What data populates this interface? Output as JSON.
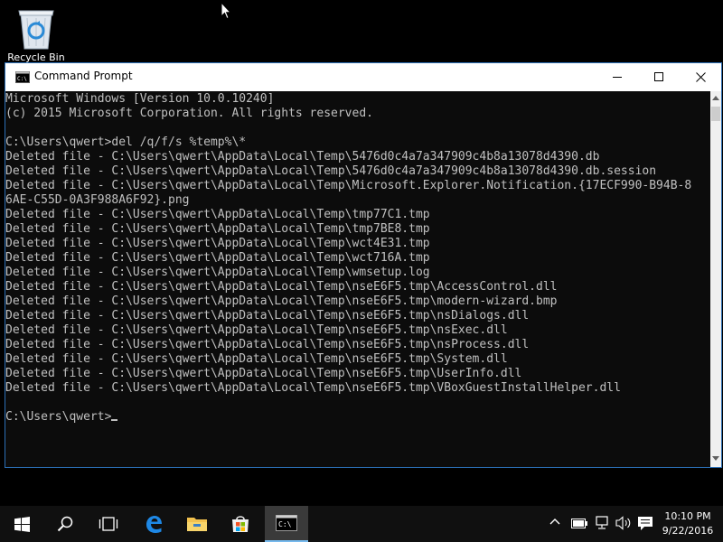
{
  "desktop": {
    "icons": [
      {
        "label": "Recycle Bin",
        "icon": "recycle-bin-icon"
      }
    ]
  },
  "window": {
    "title": "Command Prompt",
    "icon": "cmd-icon",
    "controls": [
      "minimize-icon",
      "maximize-icon",
      "close-icon"
    ]
  },
  "console": {
    "lines": [
      "Microsoft Windows [Version 10.0.10240]",
      "(c) 2015 Microsoft Corporation. All rights reserved.",
      "",
      "C:\\Users\\qwert>del /q/f/s %temp%\\*",
      "Deleted file - C:\\Users\\qwert\\AppData\\Local\\Temp\\5476d0c4a7a347909c4b8a13078d4390.db",
      "Deleted file - C:\\Users\\qwert\\AppData\\Local\\Temp\\5476d0c4a7a347909c4b8a13078d4390.db.session",
      "Deleted file - C:\\Users\\qwert\\AppData\\Local\\Temp\\Microsoft.Explorer.Notification.{17ECF990-B94B-8",
      "6AE-C55D-0A3F988A6F92}.png",
      "Deleted file - C:\\Users\\qwert\\AppData\\Local\\Temp\\tmp77C1.tmp",
      "Deleted file - C:\\Users\\qwert\\AppData\\Local\\Temp\\tmp7BE8.tmp",
      "Deleted file - C:\\Users\\qwert\\AppData\\Local\\Temp\\wct4E31.tmp",
      "Deleted file - C:\\Users\\qwert\\AppData\\Local\\Temp\\wct716A.tmp",
      "Deleted file - C:\\Users\\qwert\\AppData\\Local\\Temp\\wmsetup.log",
      "Deleted file - C:\\Users\\qwert\\AppData\\Local\\Temp\\nseE6F5.tmp\\AccessControl.dll",
      "Deleted file - C:\\Users\\qwert\\AppData\\Local\\Temp\\nseE6F5.tmp\\modern-wizard.bmp",
      "Deleted file - C:\\Users\\qwert\\AppData\\Local\\Temp\\nseE6F5.tmp\\nsDialogs.dll",
      "Deleted file - C:\\Users\\qwert\\AppData\\Local\\Temp\\nseE6F5.tmp\\nsExec.dll",
      "Deleted file - C:\\Users\\qwert\\AppData\\Local\\Temp\\nseE6F5.tmp\\nsProcess.dll",
      "Deleted file - C:\\Users\\qwert\\AppData\\Local\\Temp\\nseE6F5.tmp\\System.dll",
      "Deleted file - C:\\Users\\qwert\\AppData\\Local\\Temp\\nseE6F5.tmp\\UserInfo.dll",
      "Deleted file - C:\\Users\\qwert\\AppData\\Local\\Temp\\nseE6F5.tmp\\VBoxGuestInstallHelper.dll",
      ""
    ],
    "prompt": "C:\\Users\\qwert>",
    "text_color": "#c0c0c0",
    "background_color": "#0c0c0c"
  },
  "taskbar": {
    "buttons": [
      {
        "name": "start",
        "icon": "windows-logo-icon"
      },
      {
        "name": "search",
        "icon": "search-icon"
      },
      {
        "name": "task-view",
        "icon": "task-view-icon"
      },
      {
        "name": "edge",
        "icon": "edge-icon"
      },
      {
        "name": "file-explorer",
        "icon": "folder-icon"
      },
      {
        "name": "store",
        "icon": "store-icon"
      },
      {
        "name": "command-prompt",
        "icon": "cmd-icon",
        "active": true
      }
    ],
    "tray_icons": [
      "chevron-up-icon",
      "battery-icon",
      "network-icon",
      "volume-icon",
      "notification-icon"
    ],
    "clock": {
      "time": "10:10 PM",
      "date": "9/22/2016"
    },
    "accent_color": "#76b9ed"
  }
}
